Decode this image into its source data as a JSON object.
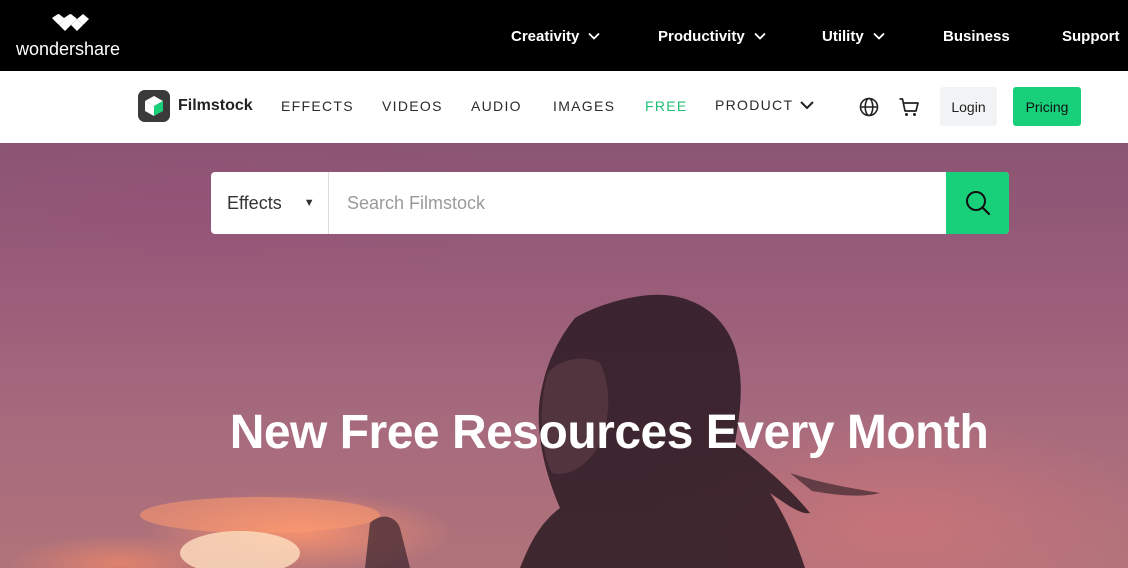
{
  "topbar": {
    "brand": "wondershare",
    "nav": [
      {
        "label": "Creativity",
        "has_dropdown": true
      },
      {
        "label": "Productivity",
        "has_dropdown": true
      },
      {
        "label": "Utility",
        "has_dropdown": true
      },
      {
        "label": "Business",
        "has_dropdown": false
      },
      {
        "label": "Support",
        "has_dropdown": false
      }
    ]
  },
  "mainnav": {
    "brand": "Filmstock",
    "links": [
      "EFFECTS",
      "VIDEOS",
      "AUDIO",
      "IMAGES",
      "FREE",
      "PRODUCT"
    ],
    "icons": [
      "globe-icon",
      "cart-icon"
    ],
    "login_label": "Login",
    "pricing_label": "Pricing",
    "accent_color": "#19d07a"
  },
  "search": {
    "category": "Effects",
    "placeholder": "Search Filmstock"
  },
  "hero": {
    "title": "New Free Resources Every Month"
  }
}
